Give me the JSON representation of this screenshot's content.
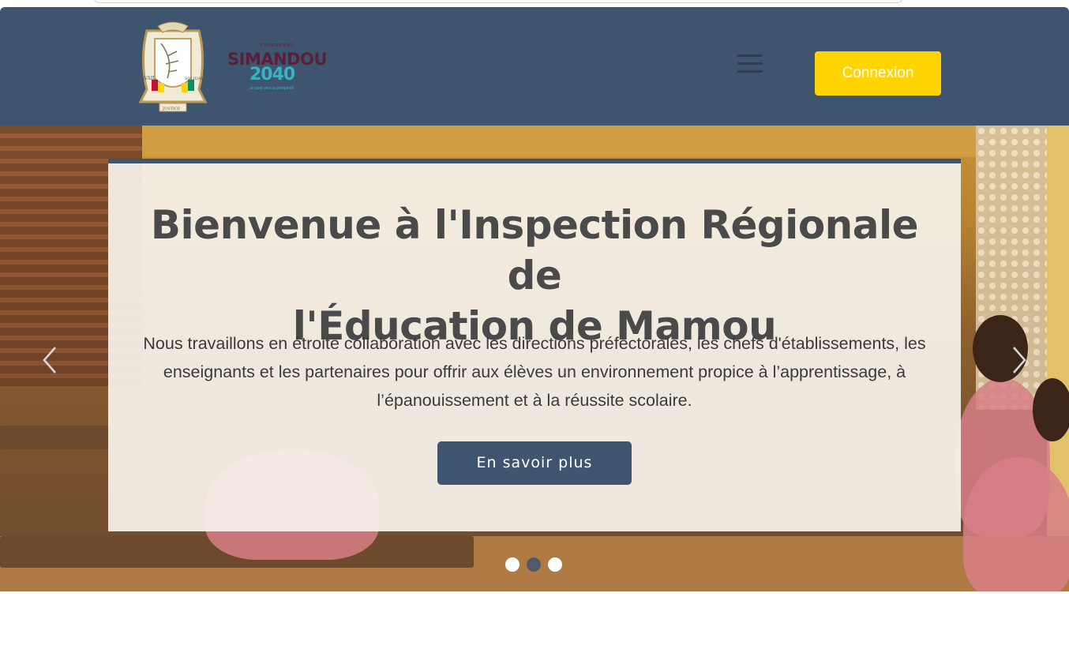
{
  "header": {
    "emblem": {
      "icon": "guinea-coat-of-arms-icon",
      "motto": [
        "TRAVAIL",
        "JUSTICE",
        "SOLIDARITÉ"
      ]
    },
    "program_logo": {
      "icon": "simandou-2040-logo",
      "small_text": "PROGRAMME",
      "word": "SIMANDOU",
      "year": "2040",
      "tagline": "un pont vers la prospérité"
    },
    "menu_icon": "hamburger-menu-icon",
    "login_label": "Connexion"
  },
  "hero": {
    "title_line1": "Bienvenue à l'Inspection Régionale de",
    "title_line2": "l'Éducation de Mamou",
    "description": "Nous travaillons en étroite collaboration avec les directions préfectorales, les chefs d'établissements, les enseignants et les partenaires pour offrir aux élèves un environnement propice à l’apprentissage, à l’épanouissement et à la réussite scolaire.",
    "cta_label": "En savoir plus",
    "prev_icon": "chevron-left-icon",
    "next_icon": "chevron-right-icon",
    "slides_total": 3,
    "active_slide": 2
  },
  "colors": {
    "navbar": "#3f556f",
    "login_button": "#ffd400",
    "cta_button": "#3f556f",
    "title_text": "#4a4a4a"
  }
}
